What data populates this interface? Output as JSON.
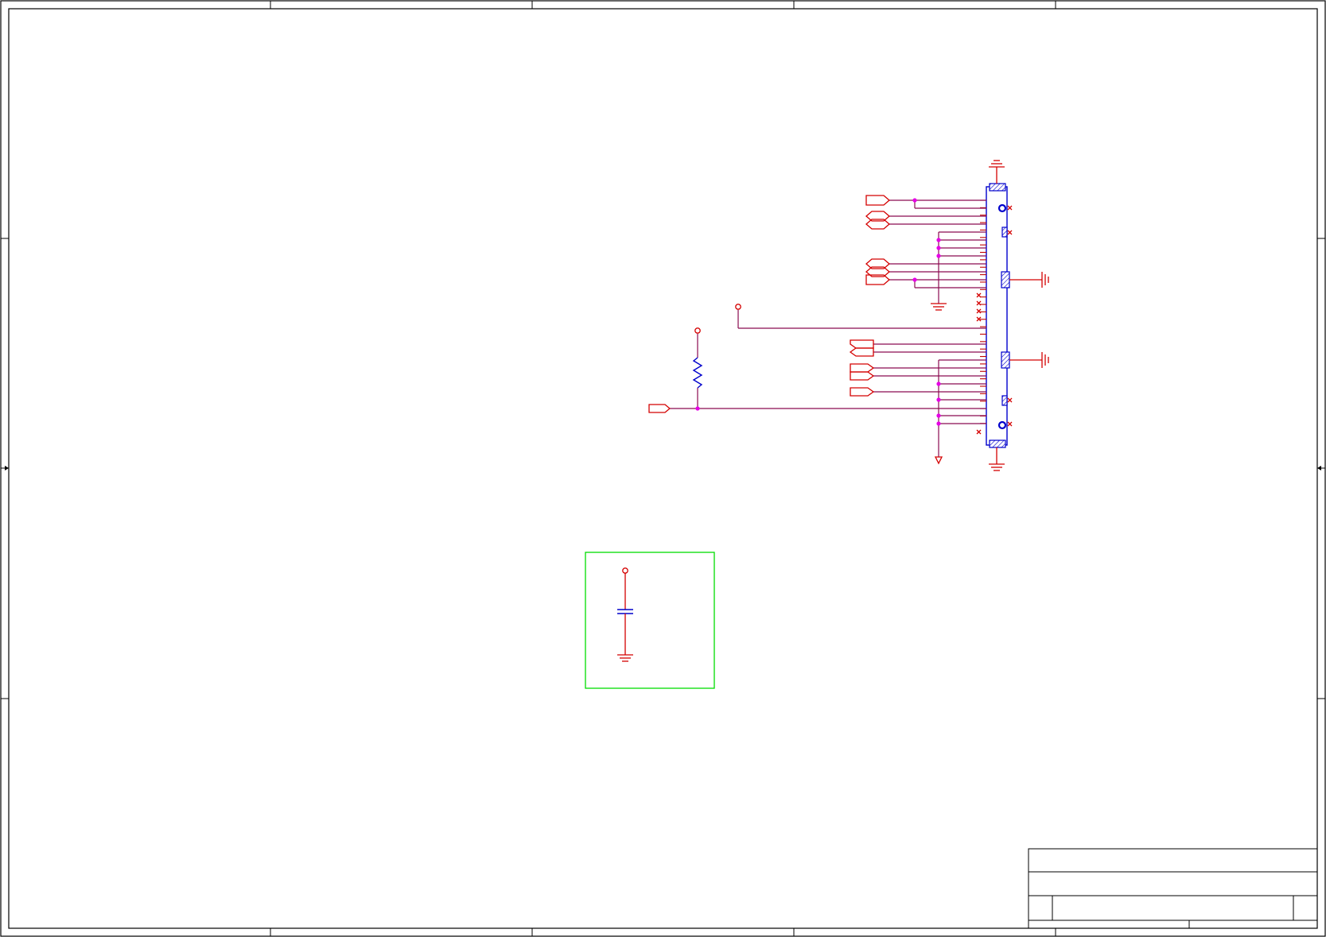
{
  "sheet": {
    "colors": {
      "border": "#000000",
      "wire": "#c00000",
      "symbol_red": "#d40000",
      "symbol_blue": "#0000cc",
      "junction": "#e600e6",
      "highlight_box": "#00dd00"
    }
  },
  "schematic": {
    "connector": {
      "pin_count": 31,
      "icon": "connector-icon"
    },
    "resistor": {
      "icon": "resistor-icon"
    },
    "capacitor": {
      "icon": "capacitor-icon"
    },
    "ground": {
      "icon": "ground-icon"
    }
  },
  "title_block": {
    "rows": 4
  }
}
